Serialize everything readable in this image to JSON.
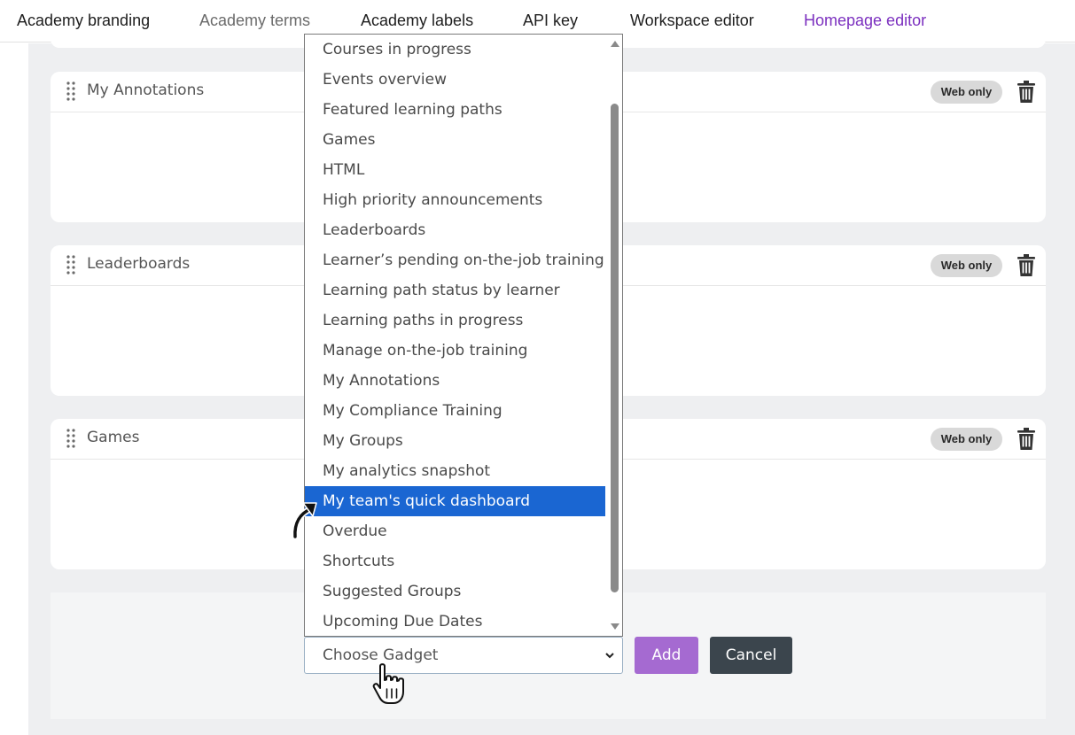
{
  "tabs": [
    {
      "label": "Academy branding"
    },
    {
      "label": "Academy terms"
    },
    {
      "label": "Academy labels"
    },
    {
      "label": "API key"
    },
    {
      "label": "Workspace editor"
    },
    {
      "label": "Homepage editor"
    }
  ],
  "active_tab": "Homepage editor",
  "colors": {
    "accent": "#7b2fbf",
    "selected": "#1a66d2",
    "add_button": "#a56ad1",
    "cancel_button": "#3b454d"
  },
  "cards": [
    {
      "title": "My Annotations",
      "badge": "Web only",
      "icons": [
        "drag-handle-icon",
        "trash-icon"
      ]
    },
    {
      "title": "Leaderboards",
      "badge": "Web only",
      "icons": [
        "drag-handle-icon",
        "trash-icon"
      ]
    },
    {
      "title": "Games",
      "badge": "Web only",
      "icons": [
        "drag-handle-icon",
        "trash-icon"
      ]
    }
  ],
  "gadget_select": {
    "value": "Choose Gadget"
  },
  "dropdown": {
    "items": [
      "Courses in progress",
      "Events overview",
      "Featured learning paths",
      "Games",
      "HTML",
      "High priority announcements",
      "Leaderboards",
      "Learner’s pending on-the-job training",
      "Learning path status by learner",
      "Learning paths in progress",
      "Manage on-the-job training",
      "My Annotations",
      "My Compliance Training",
      "My Groups",
      "My analytics snapshot",
      "My team's quick dashboard",
      "Overdue",
      "Shortcuts",
      "Suggested Groups",
      "Upcoming Due Dates"
    ],
    "selected": "My team's quick dashboard"
  },
  "buttons": {
    "add_label": "Add",
    "cancel_label": "Cancel"
  }
}
